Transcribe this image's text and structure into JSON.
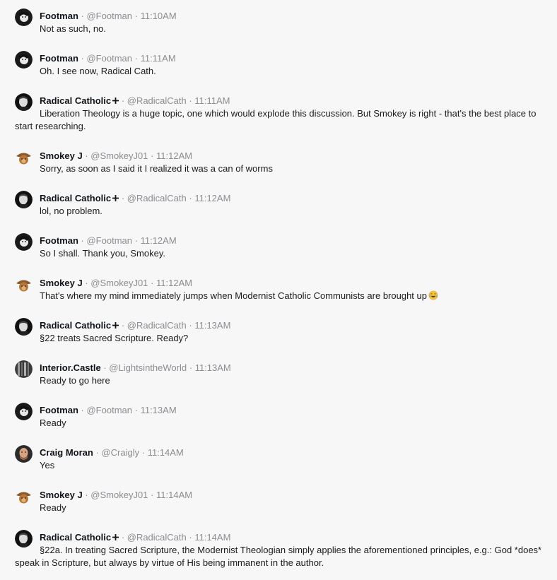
{
  "separator": "·",
  "messages": [
    {
      "name": "Footman",
      "badge": "",
      "handle": "@Footman",
      "time": "11:10AM",
      "text": "Not as such, no.",
      "avatar": "footman-avatar"
    },
    {
      "name": "Footman",
      "badge": "",
      "handle": "@Footman",
      "time": "11:11AM",
      "text": "Oh. I see now, Radical Cath.",
      "avatar": "footman-avatar"
    },
    {
      "name": "Radical Catholic",
      "badge": "cross-icon",
      "handle": "@RadicalCath",
      "time": "11:11AM",
      "text": "Liberation Theology is a huge topic, one which would explode this discussion. But Smokey is right - that's the best place to start researching.",
      "avatar": "radical-catholic-avatar"
    },
    {
      "name": "Smokey J",
      "badge": "",
      "handle": "@SmokeyJ01",
      "time": "11:12AM",
      "text": "Sorry, as soon as I said it I realized it was a can of worms",
      "avatar": "smokey-avatar"
    },
    {
      "name": "Radical Catholic",
      "badge": "cross-icon",
      "handle": "@RadicalCath",
      "time": "11:12AM",
      "text": "lol, no problem.",
      "avatar": "radical-catholic-avatar"
    },
    {
      "name": "Footman",
      "badge": "",
      "handle": "@Footman",
      "time": "11:12AM",
      "text": "So I shall. Thank you, Smokey.",
      "avatar": "footman-avatar"
    },
    {
      "name": "Smokey J",
      "badge": "",
      "handle": "@SmokeyJ01",
      "time": "11:12AM",
      "text": "That's where my mind immediately jumps when Modernist Catholic Communists are brought up",
      "emoji": "laughing-tears-icon",
      "avatar": "smokey-avatar"
    },
    {
      "name": "Radical Catholic",
      "badge": "cross-icon",
      "handle": "@RadicalCath",
      "time": "11:13AM",
      "text": "§22 treats Sacred Scripture. Ready?",
      "avatar": "radical-catholic-avatar"
    },
    {
      "name": "Interior.Castle",
      "badge": "",
      "handle": "@LightsintheWorld",
      "time": "11:13AM",
      "text": "Ready to go here",
      "avatar": "interior-castle-avatar"
    },
    {
      "name": "Footman",
      "badge": "",
      "handle": "@Footman",
      "time": "11:13AM",
      "text": "Ready",
      "avatar": "footman-avatar"
    },
    {
      "name": "Craig Moran",
      "badge": "",
      "handle": "@Craigly",
      "time": "11:14AM",
      "text": "Yes",
      "avatar": "craig-avatar"
    },
    {
      "name": "Smokey J",
      "badge": "",
      "handle": "@SmokeyJ01",
      "time": "11:14AM",
      "text": "Ready",
      "avatar": "smokey-avatar"
    },
    {
      "name": "Radical Catholic",
      "badge": "cross-icon",
      "handle": "@RadicalCath",
      "time": "11:14AM",
      "text": "§22a. In treating Sacred Scripture, the Modernist Theologian simply applies the aforementioned principles, e.g.: God *does* speak in Scripture, but always by virtue of His being immanent in the author.",
      "avatar": "radical-catholic-avatar"
    }
  ]
}
